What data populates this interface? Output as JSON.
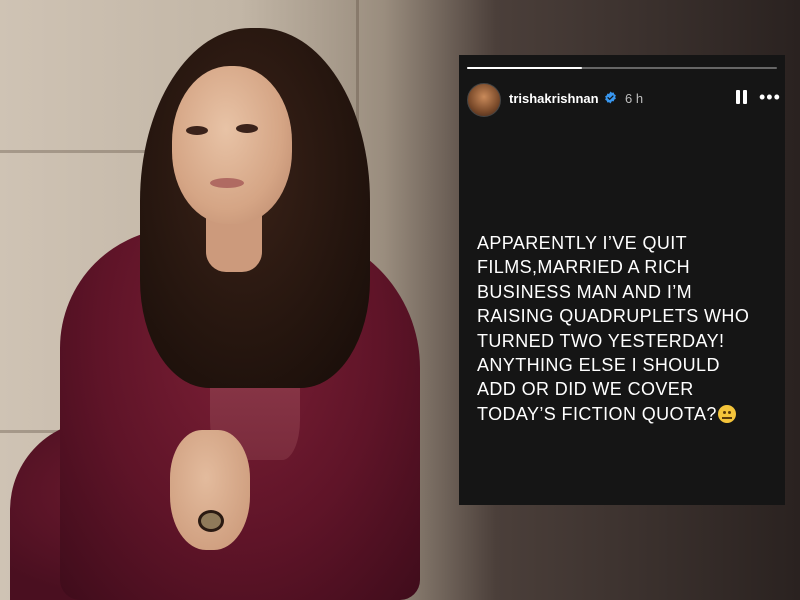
{
  "story": {
    "username": "trishakrishnan",
    "time": "6 h",
    "progress": 0.37,
    "verified_color": "#3897f0",
    "message_lines": [
      "APPARENTLY I’VE QUIT",
      "FILMS,MARRIED A RICH",
      "BUSINESS MAN AND I’M",
      "RAISING QUADRUPLETS WHO",
      "TURNED TWO YESTERDAY!",
      "ANYTHING ELSE I SHOULD",
      "ADD OR DID WE COVER",
      "TODAY’S FICTION QUOTA?"
    ],
    "icons": {
      "avatar": "profile-avatar",
      "verified": "verified-badge-icon",
      "pause": "pause-icon",
      "more": "more-options-icon",
      "emoji": "face-with-raised-eyebrow-emoji"
    },
    "more_glyph": "•••"
  }
}
